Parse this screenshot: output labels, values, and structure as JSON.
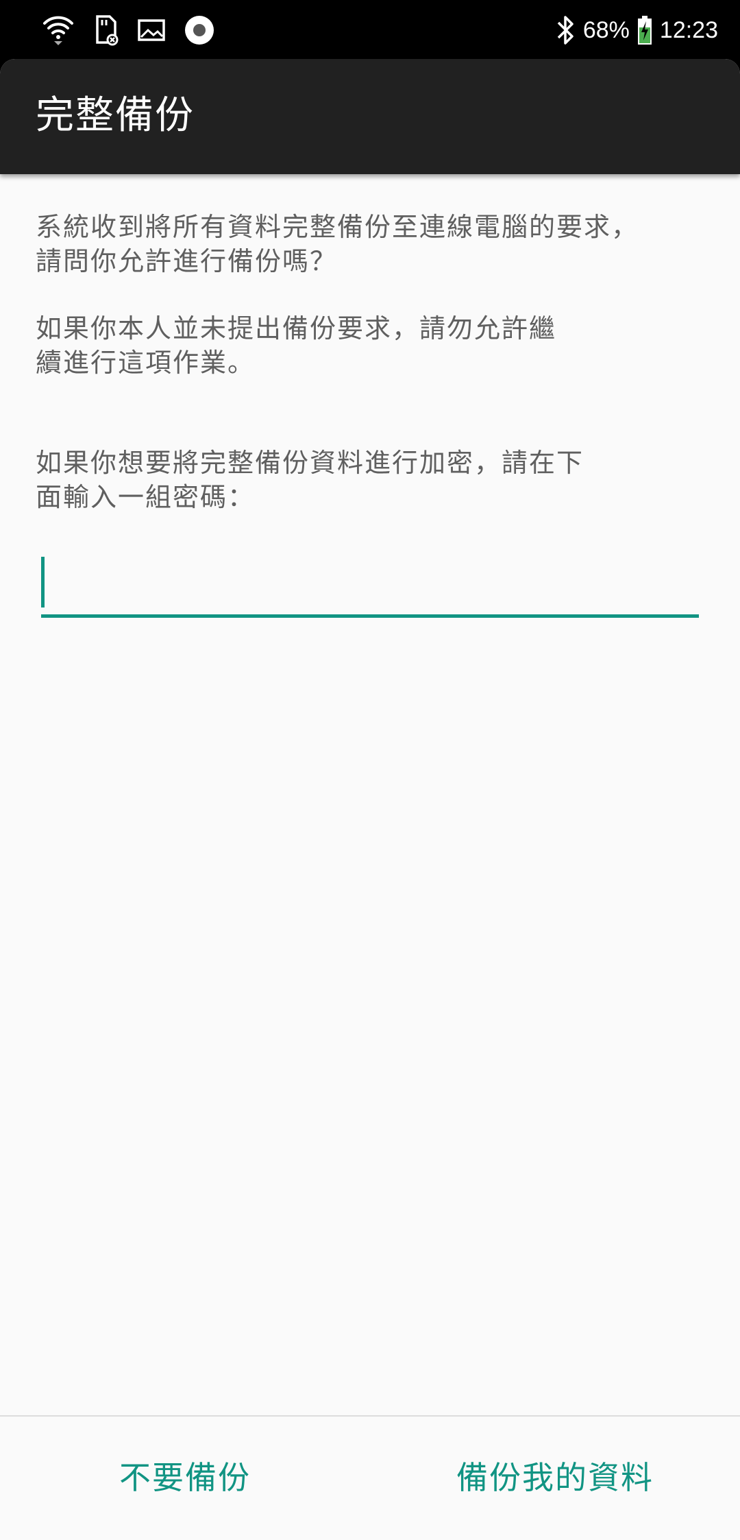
{
  "status_bar": {
    "battery": "68%",
    "time": "12:23",
    "icons": [
      "wifi-icon",
      "sd-card-icon",
      "image-icon",
      "record-icon",
      "bluetooth-icon",
      "battery-charging-icon"
    ]
  },
  "app_bar": {
    "title": "完整備份"
  },
  "content": {
    "paragraph_1": "系統收到將所有資料完整備份至連線電腦的要求，\n請問你允許進行備份嗎？",
    "paragraph_2": "如果你本人並未提出備份要求，請勿允許繼\n續進行這項作業。",
    "paragraph_3": "如果你想要將完整備份資料進行加密，請在下\n面輸入一組密碼："
  },
  "password_input": {
    "value": "",
    "placeholder": ""
  },
  "actions": {
    "deny_label": "不要備份",
    "allow_label": "備份我的資料"
  },
  "colors": {
    "accent": "#119483",
    "app_bar": "#212121",
    "background": "#fafafa"
  }
}
